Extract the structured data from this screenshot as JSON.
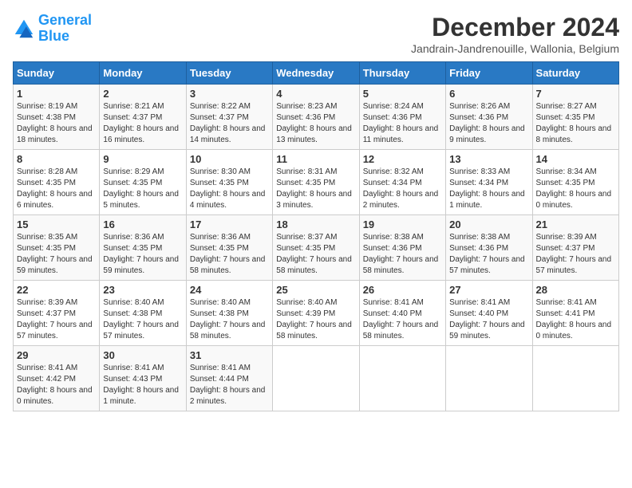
{
  "logo": {
    "line1": "General",
    "line2": "Blue"
  },
  "title": "December 2024",
  "subtitle": "Jandrain-Jandrenouille, Wallonia, Belgium",
  "weekdays": [
    "Sunday",
    "Monday",
    "Tuesday",
    "Wednesday",
    "Thursday",
    "Friday",
    "Saturday"
  ],
  "weeks": [
    [
      {
        "day": "1",
        "sunrise": "8:19 AM",
        "sunset": "4:38 PM",
        "daylight": "8 hours and 18 minutes."
      },
      {
        "day": "2",
        "sunrise": "8:21 AM",
        "sunset": "4:37 PM",
        "daylight": "8 hours and 16 minutes."
      },
      {
        "day": "3",
        "sunrise": "8:22 AM",
        "sunset": "4:37 PM",
        "daylight": "8 hours and 14 minutes."
      },
      {
        "day": "4",
        "sunrise": "8:23 AM",
        "sunset": "4:36 PM",
        "daylight": "8 hours and 13 minutes."
      },
      {
        "day": "5",
        "sunrise": "8:24 AM",
        "sunset": "4:36 PM",
        "daylight": "8 hours and 11 minutes."
      },
      {
        "day": "6",
        "sunrise": "8:26 AM",
        "sunset": "4:36 PM",
        "daylight": "8 hours and 9 minutes."
      },
      {
        "day": "7",
        "sunrise": "8:27 AM",
        "sunset": "4:35 PM",
        "daylight": "8 hours and 8 minutes."
      }
    ],
    [
      {
        "day": "8",
        "sunrise": "8:28 AM",
        "sunset": "4:35 PM",
        "daylight": "8 hours and 6 minutes."
      },
      {
        "day": "9",
        "sunrise": "8:29 AM",
        "sunset": "4:35 PM",
        "daylight": "8 hours and 5 minutes."
      },
      {
        "day": "10",
        "sunrise": "8:30 AM",
        "sunset": "4:35 PM",
        "daylight": "8 hours and 4 minutes."
      },
      {
        "day": "11",
        "sunrise": "8:31 AM",
        "sunset": "4:35 PM",
        "daylight": "8 hours and 3 minutes."
      },
      {
        "day": "12",
        "sunrise": "8:32 AM",
        "sunset": "4:34 PM",
        "daylight": "8 hours and 2 minutes."
      },
      {
        "day": "13",
        "sunrise": "8:33 AM",
        "sunset": "4:34 PM",
        "daylight": "8 hours and 1 minute."
      },
      {
        "day": "14",
        "sunrise": "8:34 AM",
        "sunset": "4:35 PM",
        "daylight": "8 hours and 0 minutes."
      }
    ],
    [
      {
        "day": "15",
        "sunrise": "8:35 AM",
        "sunset": "4:35 PM",
        "daylight": "7 hours and 59 minutes."
      },
      {
        "day": "16",
        "sunrise": "8:36 AM",
        "sunset": "4:35 PM",
        "daylight": "7 hours and 59 minutes."
      },
      {
        "day": "17",
        "sunrise": "8:36 AM",
        "sunset": "4:35 PM",
        "daylight": "7 hours and 58 minutes."
      },
      {
        "day": "18",
        "sunrise": "8:37 AM",
        "sunset": "4:35 PM",
        "daylight": "7 hours and 58 minutes."
      },
      {
        "day": "19",
        "sunrise": "8:38 AM",
        "sunset": "4:36 PM",
        "daylight": "7 hours and 58 minutes."
      },
      {
        "day": "20",
        "sunrise": "8:38 AM",
        "sunset": "4:36 PM",
        "daylight": "7 hours and 57 minutes."
      },
      {
        "day": "21",
        "sunrise": "8:39 AM",
        "sunset": "4:37 PM",
        "daylight": "7 hours and 57 minutes."
      }
    ],
    [
      {
        "day": "22",
        "sunrise": "8:39 AM",
        "sunset": "4:37 PM",
        "daylight": "7 hours and 57 minutes."
      },
      {
        "day": "23",
        "sunrise": "8:40 AM",
        "sunset": "4:38 PM",
        "daylight": "7 hours and 57 minutes."
      },
      {
        "day": "24",
        "sunrise": "8:40 AM",
        "sunset": "4:38 PM",
        "daylight": "7 hours and 58 minutes."
      },
      {
        "day": "25",
        "sunrise": "8:40 AM",
        "sunset": "4:39 PM",
        "daylight": "7 hours and 58 minutes."
      },
      {
        "day": "26",
        "sunrise": "8:41 AM",
        "sunset": "4:40 PM",
        "daylight": "7 hours and 58 minutes."
      },
      {
        "day": "27",
        "sunrise": "8:41 AM",
        "sunset": "4:40 PM",
        "daylight": "7 hours and 59 minutes."
      },
      {
        "day": "28",
        "sunrise": "8:41 AM",
        "sunset": "4:41 PM",
        "daylight": "8 hours and 0 minutes."
      }
    ],
    [
      {
        "day": "29",
        "sunrise": "8:41 AM",
        "sunset": "4:42 PM",
        "daylight": "8 hours and 0 minutes."
      },
      {
        "day": "30",
        "sunrise": "8:41 AM",
        "sunset": "4:43 PM",
        "daylight": "8 hours and 1 minute."
      },
      {
        "day": "31",
        "sunrise": "8:41 AM",
        "sunset": "4:44 PM",
        "daylight": "8 hours and 2 minutes."
      },
      null,
      null,
      null,
      null
    ]
  ]
}
